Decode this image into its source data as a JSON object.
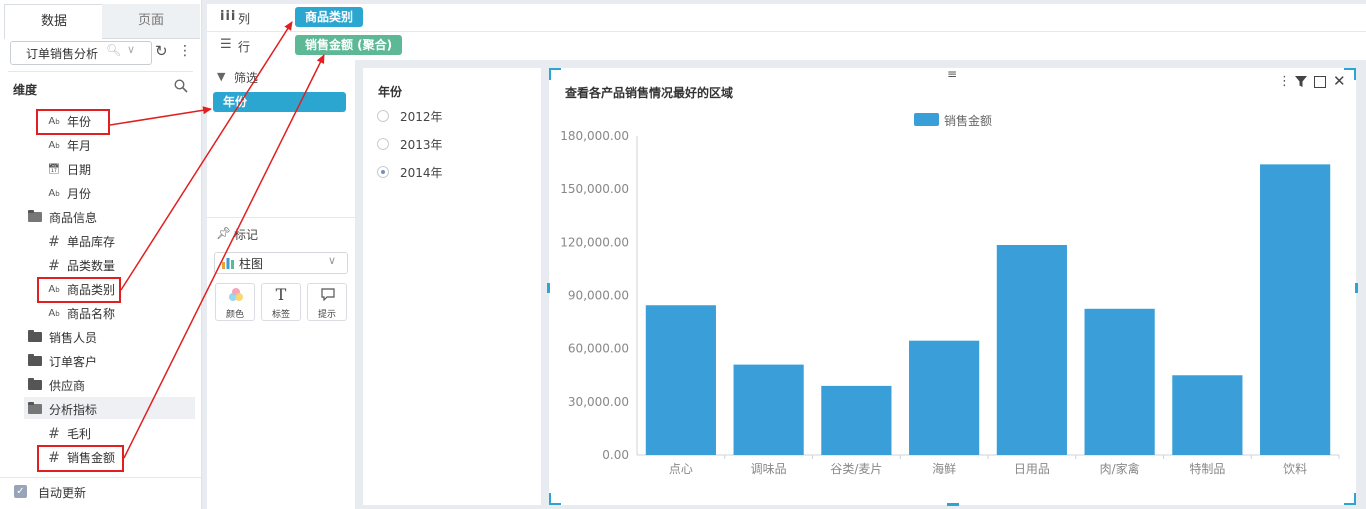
{
  "left_panel": {
    "tabs": [
      "数据",
      "页面"
    ],
    "datasource": "订单销售分析",
    "dimensions_title": "维度",
    "auto_update": "自动更新",
    "fields": [
      {
        "icon": "text",
        "label": "年份",
        "indent": 2
      },
      {
        "icon": "text",
        "label": "年月",
        "indent": 2
      },
      {
        "icon": "date",
        "label": "日期",
        "indent": 2
      },
      {
        "icon": "text",
        "label": "月份",
        "indent": 2
      },
      {
        "icon": "folder-open",
        "label": "商品信息",
        "indent": 1
      },
      {
        "icon": "number",
        "label": "单品库存",
        "indent": 2
      },
      {
        "icon": "number",
        "label": "品类数量",
        "indent": 2
      },
      {
        "icon": "text",
        "label": "商品类别",
        "indent": 2
      },
      {
        "icon": "text",
        "label": "商品名称",
        "indent": 2
      },
      {
        "icon": "folder",
        "label": "销售人员",
        "indent": 1
      },
      {
        "icon": "folder",
        "label": "订单客户",
        "indent": 1
      },
      {
        "icon": "folder",
        "label": "供应商",
        "indent": 1
      },
      {
        "icon": "folder-open",
        "label": "分析指标",
        "indent": 1
      },
      {
        "icon": "number",
        "label": "毛利",
        "indent": 2
      },
      {
        "icon": "number",
        "label": "销售金额",
        "indent": 2
      }
    ]
  },
  "shelves": {
    "column": {
      "label": "列",
      "pill": "商品类别"
    },
    "row": {
      "label": "行",
      "pill": "销售金额 (聚合)"
    }
  },
  "middle_panel": {
    "filter_label": "筛选",
    "filter_pill": "年份",
    "mark_label": "标记",
    "chart_type": "柱图",
    "buttons": [
      "颜色",
      "标签",
      "提示"
    ]
  },
  "filter_list": {
    "title": "年份",
    "options": [
      {
        "label": "2012年",
        "selected": false
      },
      {
        "label": "2013年",
        "selected": false
      },
      {
        "label": "2014年",
        "selected": true
      }
    ]
  },
  "chart_data": {
    "type": "bar",
    "title": "查看各产品销售情况最好的区域",
    "categories": [
      "点心",
      "调味品",
      "谷类/麦片",
      "海鲜",
      "日用品",
      "肉/家禽",
      "特制品",
      "饮料"
    ],
    "series": [
      {
        "name": "销售金额",
        "values": [
          84500,
          51000,
          39000,
          64500,
          118500,
          82500,
          45000,
          164000
        ],
        "color": "#3a9fd8"
      }
    ],
    "yticks": [
      "0.00",
      "30,000.00",
      "60,000.00",
      "90,000.00",
      "120,000.00",
      "150,000.00",
      "180,000.00"
    ],
    "ylim": [
      0,
      180000
    ],
    "grid": false,
    "legend": "top-center"
  }
}
